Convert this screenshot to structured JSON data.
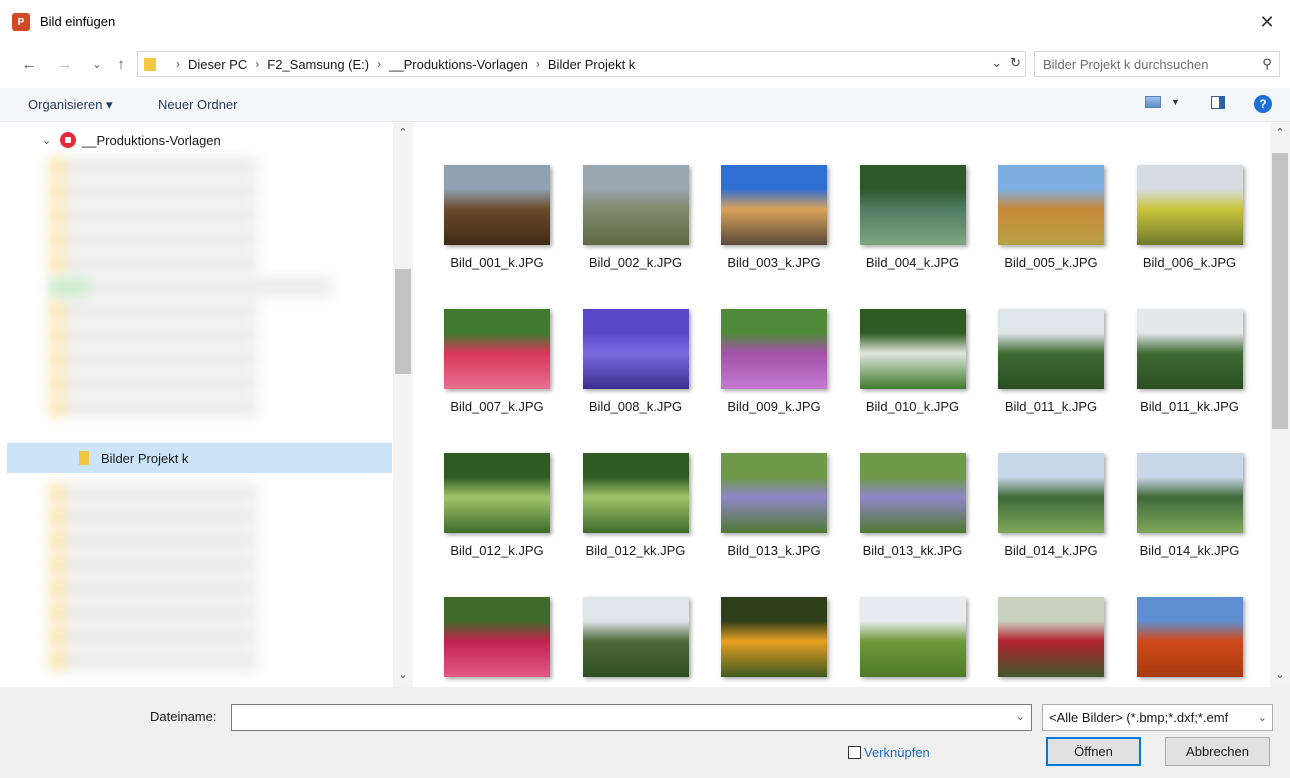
{
  "window": {
    "title": "Bild einfügen",
    "app_icon_glyph": "P"
  },
  "nav": {
    "breadcrumb": [
      "Dieser PC",
      "F2_Samsung (E:)",
      "__Produktions-Vorlagen",
      "Bilder Projekt k"
    ],
    "search_placeholder": "Bilder Projekt k durchsuchen"
  },
  "toolbar": {
    "organize_label": "Organisieren ▾",
    "new_folder_label": "Neuer Ordner"
  },
  "tree": {
    "root_label": "__Produktions-Vorlagen",
    "selected_label": "Bilder Projekt k"
  },
  "files": [
    {
      "name": "Bild_001_k.JPG",
      "colors": [
        "#8fa1b3",
        "#6b4a2a",
        "#3f2a16"
      ]
    },
    {
      "name": "Bild_002_k.JPG",
      "colors": [
        "#9aa6b0",
        "#7f8b6c",
        "#5d6a43"
      ]
    },
    {
      "name": "Bild_003_k.JPG",
      "colors": [
        "#2f6fd1",
        "#d9a25a",
        "#5b4a3a"
      ]
    },
    {
      "name": "Bild_004_k.JPG",
      "colors": [
        "#2c5a2a",
        "#4f7c62",
        "#7da77f"
      ]
    },
    {
      "name": "Bild_005_k.JPG",
      "colors": [
        "#7faee0",
        "#c98a3a",
        "#b8a047"
      ]
    },
    {
      "name": "Bild_006_k.JPG",
      "colors": [
        "#d6dde2",
        "#c9c43a",
        "#6f7a2a"
      ]
    },
    {
      "name": "Bild_007_k.JPG",
      "colors": [
        "#3f7a2f",
        "#d9365a",
        "#e86f8f"
      ]
    },
    {
      "name": "Bild_008_k.JPG",
      "colors": [
        "#5a47c8",
        "#7b6be0",
        "#3a2f8f"
      ]
    },
    {
      "name": "Bild_009_k.JPG",
      "colors": [
        "#4f8a3a",
        "#a352a8",
        "#c27ad0"
      ]
    },
    {
      "name": "Bild_010_k.JPG",
      "colors": [
        "#2f5a22",
        "#dfe6dc",
        "#3f7a2f"
      ]
    },
    {
      "name": "Bild_011_k.JPG",
      "colors": [
        "#dfe6ea",
        "#3f6a32",
        "#2a4f22"
      ]
    },
    {
      "name": "Bild_011_kk.JPG",
      "colors": [
        "#e3e8eb",
        "#3f6a32",
        "#2a4f22"
      ]
    },
    {
      "name": "Bild_012_k.JPG",
      "colors": [
        "#2f5a22",
        "#9fc56a",
        "#3f6a2a"
      ]
    },
    {
      "name": "Bild_012_kk.JPG",
      "colors": [
        "#2f5a22",
        "#9fc56a",
        "#3f6a2a"
      ]
    },
    {
      "name": "Bild_013_k.JPG",
      "colors": [
        "#6f9a4a",
        "#8f86c8",
        "#4f7a32"
      ]
    },
    {
      "name": "Bild_013_kk.JPG",
      "colors": [
        "#6f9a4a",
        "#8f86c8",
        "#4f7a32"
      ]
    },
    {
      "name": "Bild_014_k.JPG",
      "colors": [
        "#c9d8e8",
        "#3f6a3a",
        "#7fa85a"
      ]
    },
    {
      "name": "Bild_014_kk.JPG",
      "colors": [
        "#c9d8e8",
        "#3f6a3a",
        "#7fa85a"
      ]
    },
    {
      "name": "",
      "colors": [
        "#3f6a2a",
        "#c2224f",
        "#e35a86"
      ]
    },
    {
      "name": "",
      "colors": [
        "#dfe6ea",
        "#4f6a3a",
        "#2f4f22"
      ]
    },
    {
      "name": "",
      "colors": [
        "#2f3f1a",
        "#e8a022",
        "#3f5a1f"
      ]
    },
    {
      "name": "",
      "colors": [
        "#e6ecef",
        "#6f9a3a",
        "#4f7a2a"
      ]
    },
    {
      "name": "",
      "colors": [
        "#c9d2c0",
        "#b3222f",
        "#3f5a2a"
      ]
    },
    {
      "name": "",
      "colors": [
        "#5f8fd0",
        "#d24a1a",
        "#a83a12"
      ]
    }
  ],
  "bottom": {
    "filename_label": "Dateiname:",
    "filename_value": "",
    "filter_value": "<Alle Bilder> (*.bmp;*.dxf;*.emf",
    "link_label": "Verknüpfen",
    "open_label": "Öffnen",
    "cancel_label": "Abbrechen"
  }
}
